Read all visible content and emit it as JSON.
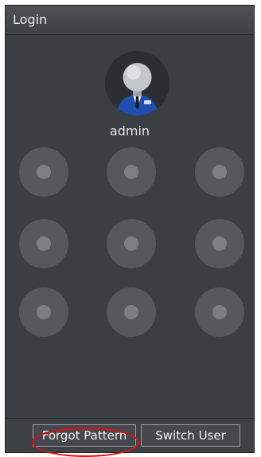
{
  "window": {
    "title": "Login"
  },
  "user": {
    "name": "admin",
    "avatar_icon": "user-avatar-icon"
  },
  "pattern": {
    "rows": 3,
    "cols": 3,
    "dot_color": "#55585d",
    "dot_core_color": "#7b7e83"
  },
  "buttons": {
    "forgot_pattern": "Forgot Pattern",
    "switch_user": "Switch User"
  },
  "annotation": {
    "highlight_color": "#e01010",
    "highlight_shape": "ellipse"
  }
}
